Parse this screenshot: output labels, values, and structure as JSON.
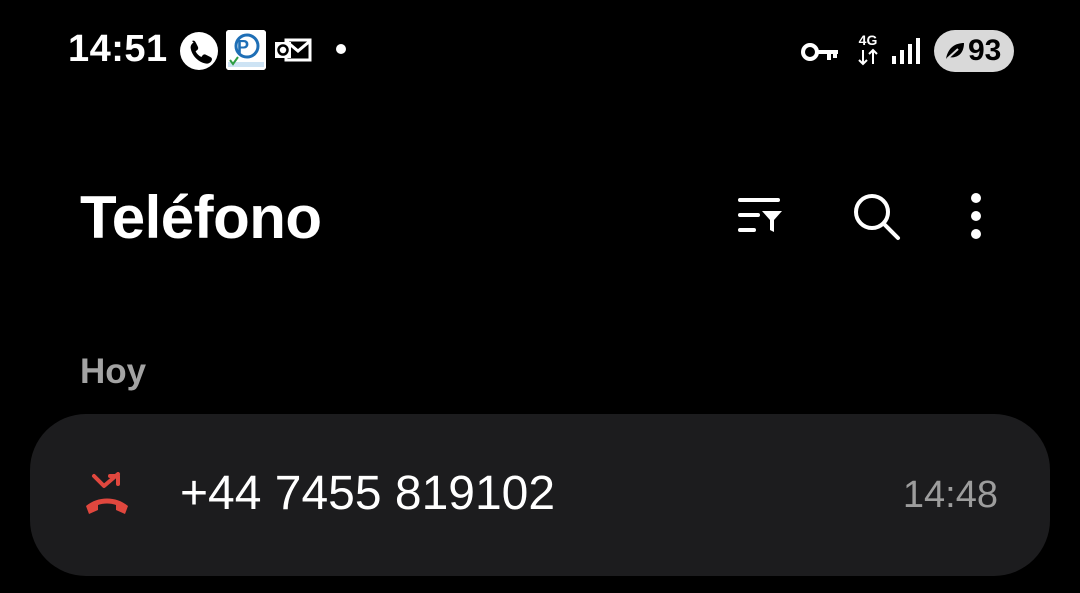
{
  "status_bar": {
    "time": "14:51",
    "network": "4G",
    "battery_level": "93",
    "icons": [
      "phone-call-icon",
      "app-notification-icon",
      "outlook-mail-icon",
      "more-notifications-dot",
      "vpn-key-icon",
      "signal-icon",
      "battery-icon"
    ]
  },
  "header": {
    "title": "Teléfono",
    "actions": [
      "filter-icon",
      "search-icon",
      "more-options-icon"
    ]
  },
  "sections": [
    {
      "label": "Hoy",
      "calls": [
        {
          "number": "+44 7455 819102",
          "time": "14:48",
          "type": "missed",
          "icon": "missed-call-icon",
          "icon_color": "#e0473e"
        }
      ]
    }
  ],
  "colors": {
    "background": "#000000",
    "card": "#1c1c1e",
    "missed": "#e0473e",
    "secondary_text": "#9d9d9d"
  }
}
